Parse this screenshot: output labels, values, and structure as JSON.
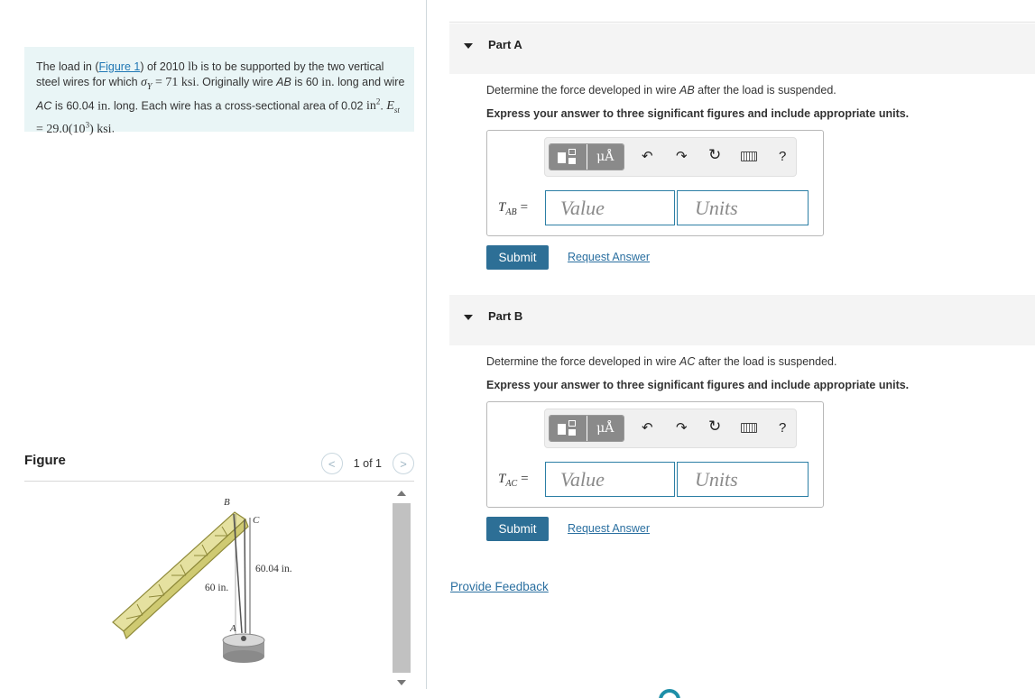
{
  "problem": {
    "text_1": "The load in (",
    "figure_link": "Figure 1",
    "text_2": ") of 2010 ",
    "unit_lb": "lb",
    "text_3": " is to be supported by the two vertical steel wires for which ",
    "sigma_sym": "σ",
    "sigma_sub": "Y",
    "sigma_val": " = 71 ",
    "unit_ksi": "ksi",
    "text_4": ". Originally wire ",
    "wire_ab": "AB",
    "text_5": " is 60 ",
    "unit_in": "in.",
    "text_6": " long and wire ",
    "wire_ac": "AC",
    "text_7": " is 60.04 ",
    "unit_in2": "in.",
    "text_8": " long. Each wire has a cross-sectional area of 0.02 ",
    "unit_area": "in",
    "area_exp": "2",
    "text_9": ". ",
    "E_sym": "E",
    "E_sub": "st",
    "E_val": " = 29.0(10",
    "E_exp": "3",
    "E_close": ") ",
    "unit_ksi2": "ksi",
    "text_10": "."
  },
  "figure": {
    "title": "Figure",
    "prev_icon": "chevron-left-icon",
    "next_icon": "chevron-right-icon",
    "prev_glyph": "<",
    "next_glyph": ">",
    "pager_count": "1 of 1",
    "labels": {
      "B": "B",
      "C": "C",
      "A": "A",
      "len_ac": "60.04 in.",
      "len_ab": "60 in."
    }
  },
  "parts": [
    {
      "label": "Part A",
      "prompt_1": "Determine the force developed in wire ",
      "prompt_wire": "AB",
      "prompt_2": " after the load is suspended.",
      "instruction": "Express your answer to three significant figures and include appropriate units.",
      "var_sym": "T",
      "var_sub": "AB",
      "var_eq": "=",
      "value_placeholder": "Value",
      "units_placeholder": "Units",
      "submit": "Submit",
      "request": "Request Answer"
    },
    {
      "label": "Part B",
      "prompt_1": "Determine the force developed in wire ",
      "prompt_wire": "AC",
      "prompt_2": " after the load is suspended.",
      "instruction": "Express your answer to three significant figures and include appropriate units.",
      "var_sym": "T",
      "var_sub": "AC",
      "var_eq": "=",
      "value_placeholder": "Value",
      "units_placeholder": "Units",
      "submit": "Submit",
      "request": "Request Answer"
    }
  ],
  "toolbar": {
    "units_glyph": "μÅ",
    "undo_glyph": "↶",
    "redo_glyph": "↷",
    "reset_glyph": "↻",
    "help_glyph": "?",
    "icons": [
      "fraction-template-icon",
      "units-icon",
      "undo-icon",
      "redo-icon",
      "reset-icon",
      "keyboard-icon",
      "help-icon"
    ]
  },
  "footer": {
    "feedback": "Provide Feedback"
  },
  "colors": {
    "problem_bg": "#e9f5f6",
    "link": "#2a6fa0",
    "submit_bg": "#2d6f96",
    "input_border": "#2c7fa5"
  }
}
